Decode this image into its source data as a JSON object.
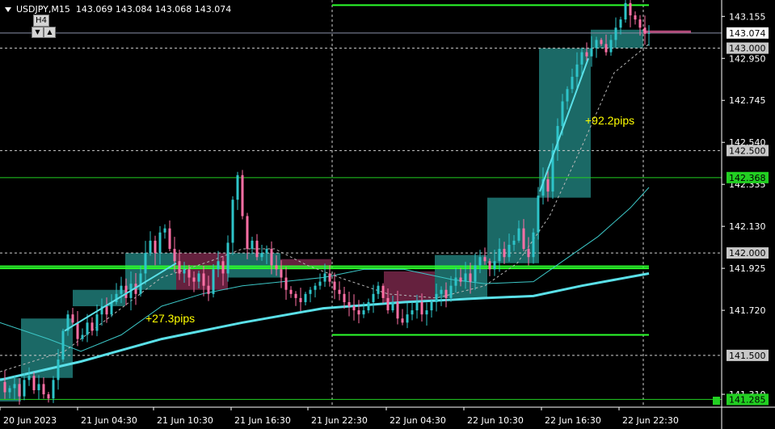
{
  "header": {
    "symbol": "USDJPY,M15",
    "ohlc": "143.069 143.084 143.068 143.074"
  },
  "timeframe": {
    "label": "H4",
    "down_icon": "triangle-down-icon",
    "up_icon": "triangle-up-icon"
  },
  "annotations": {
    "gain1": "+27.3pips",
    "gain2": "+92.2pips"
  },
  "colors": {
    "background": "#000000",
    "bull": "#2ec4c9",
    "bear": "#ff6fa5",
    "teal_box": "#1c6f6c",
    "maroon_box": "#6a2341",
    "ma_fast": "#5ae0e8",
    "green_level": "#2cff2c",
    "annotation": "#ffff00"
  },
  "chart_data": {
    "type": "candlestick",
    "symbol": "USDJPY",
    "timeframe": "M15",
    "x_ticks": [
      "20 Jun 2023",
      "21 Jun 04:30",
      "21 Jun 10:30",
      "21 Jun 16:30",
      "21 Jun 22:30",
      "22 Jun 04:30",
      "22 Jun 10:30",
      "22 Jun 16:30",
      "22 Jun 22:30"
    ],
    "y_ticks": [
      141.285,
      141.5,
      141.72,
      141.925,
      142.0,
      142.13,
      142.335,
      142.368,
      142.5,
      142.54,
      142.745,
      142.95,
      143.0,
      143.155
    ],
    "y_tick_labels": [
      "141.285",
      "141.500",
      "141.720",
      "141.925",
      "142.000",
      "142.130",
      "142.335",
      "142.368",
      "142.500",
      "142.540",
      "142.745",
      "142.950",
      "143.000",
      "143.155"
    ],
    "ylim": [
      141.255,
      143.235
    ],
    "current_price": 143.074,
    "current_price_label": "143.074",
    "highlighted_levels": [
      {
        "value": 142.368,
        "label": "142.368",
        "style": "green-box"
      },
      {
        "value": 141.285,
        "label": "141.285",
        "style": "green-box"
      }
    ],
    "gray_levels": [
      {
        "value": 143.0,
        "label": "143.000"
      },
      {
        "value": 142.5,
        "label": "142.500"
      },
      {
        "value": 142.0,
        "label": "142.000"
      },
      {
        "value": 141.5,
        "label": "141.500"
      }
    ],
    "plain_tick_labels": [
      "143.155",
      "142.950",
      "142.745",
      "142.540",
      "142.335",
      "142.130",
      "141.925",
      "141.720",
      "141.310"
    ],
    "plain_tick_values": [
      143.155,
      142.95,
      142.745,
      142.54,
      142.335,
      142.13,
      141.925,
      141.72,
      141.31
    ],
    "candles_summary": "M15 candles from 20 Jun 2023 through 22 Jun 22:30",
    "price_path": [
      [
        0,
        141.37
      ],
      [
        6,
        141.32
      ],
      [
        12,
        141.34
      ],
      [
        18,
        141.36
      ],
      [
        24,
        141.3
      ],
      [
        30,
        141.38
      ],
      [
        36,
        141.4
      ],
      [
        42,
        141.33
      ],
      [
        48,
        141.36
      ],
      [
        54,
        141.31
      ],
      [
        60,
        141.29
      ],
      [
        66,
        141.38
      ],
      [
        72,
        141.48
      ],
      [
        78,
        141.62
      ],
      [
        84,
        141.7
      ],
      [
        90,
        141.66
      ],
      [
        96,
        141.58
      ],
      [
        102,
        141.6
      ],
      [
        108,
        141.66
      ],
      [
        114,
        141.62
      ],
      [
        120,
        141.7
      ],
      [
        126,
        141.74
      ],
      [
        132,
        141.7
      ],
      [
        138,
        141.76
      ],
      [
        144,
        141.8
      ],
      [
        150,
        141.84
      ],
      [
        156,
        141.78
      ],
      [
        162,
        141.85
      ],
      [
        168,
        141.8
      ],
      [
        174,
        141.9
      ],
      [
        180,
        142.0
      ],
      [
        186,
        142.06
      ],
      [
        192,
        142.0
      ],
      [
        198,
        142.1
      ],
      [
        204,
        142.12
      ],
      [
        210,
        142.02
      ],
      [
        216,
        141.96
      ],
      [
        222,
        141.9
      ],
      [
        228,
        141.92
      ],
      [
        234,
        141.88
      ],
      [
        240,
        141.86
      ],
      [
        246,
        141.9
      ],
      [
        252,
        141.84
      ],
      [
        258,
        141.8
      ],
      [
        264,
        141.92
      ],
      [
        270,
        141.96
      ],
      [
        276,
        141.9
      ],
      [
        282,
        142.05
      ],
      [
        288,
        142.26
      ],
      [
        294,
        142.38
      ],
      [
        300,
        142.18
      ],
      [
        306,
        142.02
      ],
      [
        312,
        142.06
      ],
      [
        318,
        141.98
      ],
      [
        324,
        142.0
      ],
      [
        330,
        142.02
      ],
      [
        336,
        141.94
      ],
      [
        342,
        141.92
      ],
      [
        348,
        141.88
      ],
      [
        354,
        141.82
      ],
      [
        360,
        141.8
      ],
      [
        366,
        141.78
      ],
      [
        372,
        141.76
      ],
      [
        378,
        141.8
      ],
      [
        384,
        141.82
      ],
      [
        390,
        141.84
      ],
      [
        396,
        141.86
      ],
      [
        402,
        141.9
      ],
      [
        408,
        141.86
      ],
      [
        414,
        141.82
      ],
      [
        420,
        141.8
      ],
      [
        426,
        141.76
      ],
      [
        432,
        141.74
      ],
      [
        438,
        141.72
      ],
      [
        444,
        141.7
      ],
      [
        450,
        141.72
      ],
      [
        456,
        141.76
      ],
      [
        462,
        141.8
      ],
      [
        468,
        141.84
      ],
      [
        474,
        141.78
      ],
      [
        480,
        141.72
      ],
      [
        486,
        141.76
      ],
      [
        492,
        141.68
      ],
      [
        498,
        141.66
      ],
      [
        504,
        141.7
      ],
      [
        510,
        141.72
      ],
      [
        516,
        141.76
      ],
      [
        522,
        141.7
      ],
      [
        528,
        141.72
      ],
      [
        534,
        141.76
      ],
      [
        540,
        141.8
      ],
      [
        546,
        141.82
      ],
      [
        552,
        141.78
      ],
      [
        558,
        141.84
      ],
      [
        564,
        141.88
      ],
      [
        570,
        141.86
      ],
      [
        576,
        141.9
      ],
      [
        582,
        141.86
      ],
      [
        588,
        141.94
      ],
      [
        594,
        141.98
      ],
      [
        600,
        141.96
      ],
      [
        606,
        141.92
      ],
      [
        612,
        141.96
      ],
      [
        618,
        142.02
      ],
      [
        624,
        141.98
      ],
      [
        630,
        142.04
      ],
      [
        636,
        142.06
      ],
      [
        642,
        142.12
      ],
      [
        648,
        142.02
      ],
      [
        654,
        141.98
      ],
      [
        660,
        142.1
      ],
      [
        666,
        142.28
      ],
      [
        672,
        142.36
      ],
      [
        678,
        142.3
      ],
      [
        684,
        142.5
      ],
      [
        690,
        142.62
      ],
      [
        696,
        142.74
      ],
      [
        702,
        142.8
      ],
      [
        708,
        142.86
      ],
      [
        714,
        142.92
      ],
      [
        720,
        142.98
      ],
      [
        726,
        142.96
      ],
      [
        732,
        143.0
      ],
      [
        738,
        143.04
      ],
      [
        744,
        143.02
      ],
      [
        750,
        142.98
      ],
      [
        756,
        143.04
      ],
      [
        762,
        143.1
      ],
      [
        768,
        143.14
      ],
      [
        774,
        143.22
      ],
      [
        780,
        143.16
      ],
      [
        786,
        143.14
      ],
      [
        792,
        143.1
      ],
      [
        798,
        143.07
      ],
      [
        803,
        143.074
      ]
    ],
    "series": [
      {
        "name": "",
        "style": "thick-cyan",
        "points": [
          [
            0,
            141.38
          ],
          [
            100,
            141.47
          ],
          [
            200,
            141.58
          ],
          [
            300,
            141.66
          ],
          [
            400,
            141.73
          ],
          [
            500,
            141.76
          ],
          [
            600,
            141.78
          ],
          [
            660,
            141.79
          ],
          [
            720,
            141.84
          ],
          [
            803,
            141.9
          ]
        ]
      },
      {
        "name": "",
        "style": "thin-teal",
        "points": [
          [
            0,
            141.66
          ],
          [
            60,
            141.58
          ],
          [
            100,
            141.52
          ],
          [
            150,
            141.6
          ],
          [
            200,
            141.74
          ],
          [
            250,
            141.8
          ],
          [
            300,
            141.84
          ],
          [
            400,
            141.88
          ],
          [
            450,
            141.92
          ],
          [
            500,
            141.92
          ],
          [
            560,
            141.87
          ],
          [
            600,
            141.85
          ],
          [
            660,
            141.86
          ],
          [
            700,
            141.97
          ],
          [
            740,
            142.08
          ],
          [
            780,
            142.22
          ],
          [
            803,
            142.32
          ]
        ]
      },
      {
        "name": "",
        "style": "dashed",
        "points": [
          [
            0,
            141.42
          ],
          [
            80,
            141.52
          ],
          [
            140,
            141.7
          ],
          [
            200,
            141.88
          ],
          [
            260,
            141.96
          ],
          [
            300,
            142.02
          ],
          [
            340,
            142.02
          ],
          [
            380,
            141.94
          ],
          [
            420,
            141.88
          ],
          [
            480,
            141.8
          ],
          [
            540,
            141.78
          ],
          [
            600,
            141.84
          ],
          [
            640,
            141.95
          ],
          [
            680,
            142.18
          ],
          [
            720,
            142.52
          ],
          [
            760,
            142.88
          ],
          [
            803,
            143.02
          ]
        ]
      }
    ],
    "boxes": [
      {
        "x0": 0,
        "x1": 26,
        "y0": 141.275,
        "y1": 141.39,
        "kind": "teal"
      },
      {
        "x0": 26,
        "x1": 90,
        "y0": 141.39,
        "y1": 141.68,
        "kind": "teal"
      },
      {
        "x0": 90,
        "x1": 155,
        "y0": 141.74,
        "y1": 141.82,
        "kind": "teal"
      },
      {
        "x0": 155,
        "x1": 218,
        "y0": 141.82,
        "y1": 142.0,
        "kind": "teal"
      },
      {
        "x0": 218,
        "x1": 282,
        "y0": 141.82,
        "y1": 142.0,
        "kind": "maroon"
      },
      {
        "x0": 282,
        "x1": 347,
        "y0": 141.88,
        "y1": 142.0,
        "kind": "teal"
      },
      {
        "x0": 347,
        "x1": 410,
        "y0": 141.92,
        "y1": 141.97,
        "kind": "maroon"
      },
      {
        "x0": 475,
        "x1": 538,
        "y0": 141.76,
        "y1": 141.91,
        "kind": "maroon"
      },
      {
        "x0": 538,
        "x1": 603,
        "y0": 141.78,
        "y1": 141.99,
        "kind": "teal"
      },
      {
        "x0": 603,
        "x1": 667,
        "y0": 141.95,
        "y1": 142.27,
        "kind": "teal"
      },
      {
        "x0": 667,
        "x1": 731,
        "y0": 142.27,
        "y1": 143.0,
        "kind": "teal"
      },
      {
        "x0": 731,
        "x1": 796,
        "y0": 143.0,
        "y1": 143.09,
        "kind": "teal"
      }
    ],
    "trend_segments": [
      {
        "x0": 80,
        "y0": 141.62,
        "x1": 218,
        "y1": 141.95
      },
      {
        "x0": 668,
        "y0": 142.3,
        "x1": 728,
        "y1": 142.95
      }
    ],
    "vertical_dotted_x": [
      411,
      796
    ],
    "green_horizontal_lines": [
      {
        "x0": 411,
        "x1": 803,
        "y": 143.21
      },
      {
        "x0": 411,
        "x1": 803,
        "y": 141.6
      },
      {
        "x0": 0,
        "x1": 803,
        "y": 141.925
      },
      {
        "x0": 0,
        "x1": 803,
        "y": 141.935
      }
    ],
    "pink_open_line": {
      "x0": 796,
      "x1": 855,
      "y": 143.08
    }
  }
}
